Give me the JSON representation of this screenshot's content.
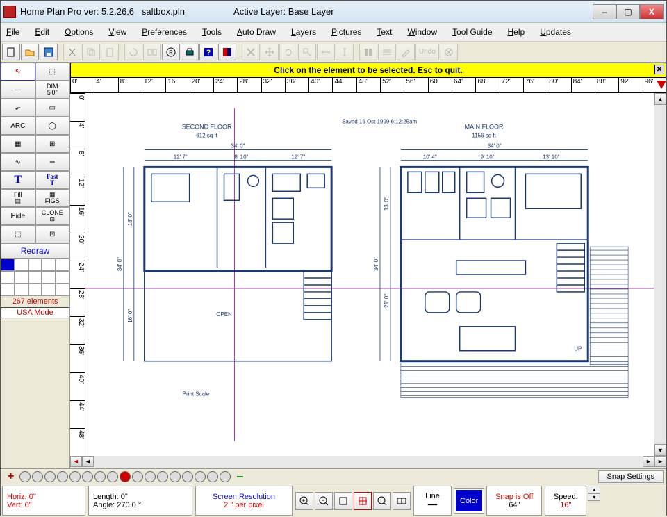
{
  "title": {
    "app": "Home Plan Pro ver: 5.2.26.6",
    "file": "saltbox.pln",
    "layer_label": "Active Layer: Base Layer"
  },
  "winbtns": {
    "min": "–",
    "max": "▢",
    "close": "X"
  },
  "menus": [
    "File",
    "Edit",
    "Options",
    "View",
    "Preferences",
    "Tools",
    "Auto Draw",
    "Layers",
    "Pictures",
    "Text",
    "Window",
    "Tool Guide",
    "Help",
    "Updates"
  ],
  "left_tools": [
    {
      "name": "pointer",
      "txt": "↖",
      "hot": true
    },
    {
      "name": "select-rect",
      "txt": "⬚"
    },
    {
      "name": "line",
      "txt": "—"
    },
    {
      "name": "dim",
      "txt": "DIM\n5'0\""
    },
    {
      "name": "polyline",
      "txt": "⬐"
    },
    {
      "name": "rect",
      "txt": "▭"
    },
    {
      "name": "arc",
      "txt": "ARC"
    },
    {
      "name": "circle",
      "txt": "◯"
    },
    {
      "name": "stairs",
      "txt": "▦"
    },
    {
      "name": "windows",
      "txt": "⊞"
    },
    {
      "name": "curve",
      "txt": "∿"
    },
    {
      "name": "parallel",
      "txt": "═"
    },
    {
      "name": "text",
      "txt": "T"
    },
    {
      "name": "fast-text",
      "txt": "Fast\nT"
    },
    {
      "name": "fill",
      "txt": "Fill\n▤"
    },
    {
      "name": "figs",
      "txt": "▦\nFIGS"
    },
    {
      "name": "hide",
      "txt": "Hide"
    },
    {
      "name": "clone",
      "txt": "CLONE\n⊡"
    },
    {
      "name": "dashed-rect",
      "txt": "⬚"
    },
    {
      "name": "chained",
      "txt": "⊡"
    }
  ],
  "redraw": "Redraw",
  "elements": "267 elements",
  "mode": "USA Mode",
  "hint": "Click on the element to be selected.  Esc to quit.",
  "ruler_h": [
    "0'",
    "4'",
    "8'",
    "12'",
    "16'",
    "20'",
    "24'",
    "28'",
    "32'",
    "36'",
    "40'",
    "44'",
    "48'",
    "52'",
    "56'",
    "60'",
    "64'",
    "68'",
    "72'",
    "76'",
    "80'",
    "84'",
    "88'",
    "92'",
    "96'"
  ],
  "ruler_v": [
    "0'",
    "4'",
    "8'",
    "12'",
    "16'",
    "20'",
    "24'",
    "28'",
    "32'",
    "36'",
    "40'",
    "44'",
    "48'"
  ],
  "plan": {
    "saved": "Saved 16 Oct 1999   6:12:25am",
    "second": {
      "title": "SECOND FLOOR",
      "area": "612 sq ft",
      "w": "34' 0\"",
      "a": "12' 7\"",
      "b": "8' 10\"",
      "c": "12' 7\"",
      "h": "34' 0\"",
      "h1": "18' 0\"",
      "h2": "16' 0\"",
      "open": "OPEN",
      "print": "Print Scale"
    },
    "main": {
      "title": "MAIN FLOOR",
      "area": "1156 sq ft",
      "w": "34' 0\"",
      "a": "10' 4\"",
      "b": "9' 10\"",
      "c": "13' 10\"",
      "h": "34' 0\"",
      "h1": "13' 0\"",
      "h2": "21' 0\"",
      "up": "UP"
    }
  },
  "toolbar": {
    "undo": "Undo"
  },
  "snap_settings": "Snap Settings",
  "status": {
    "horiz": "Horiz:  0\"",
    "vert": "Vert:  0\"",
    "length": "Length:   0\"",
    "angle": "Angle: 270.0 °",
    "res_label": "Screen Resolution",
    "res_val": "2 \" per pixel",
    "line": "Line",
    "color": "Color",
    "snap": "Snap is Off",
    "snapv": "64\"",
    "speed": "Speed:",
    "speedv": "16\""
  }
}
